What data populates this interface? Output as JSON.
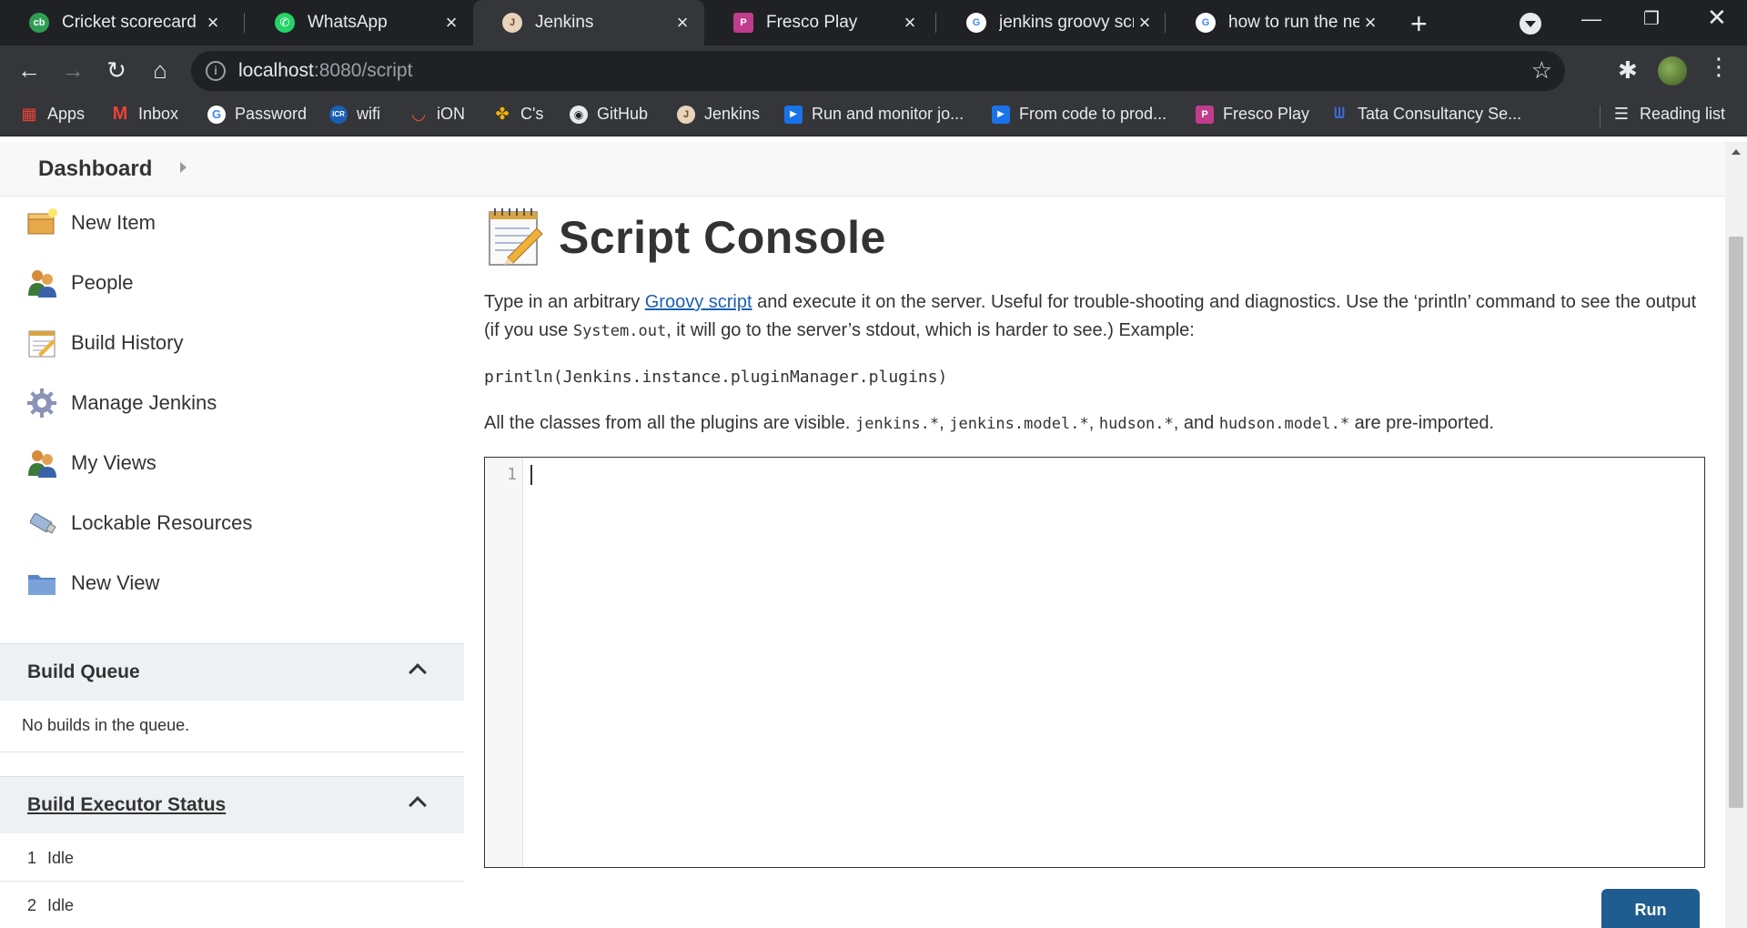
{
  "tabs": [
    {
      "title": "Cricket scorecard - I",
      "icon": "cricbuzz-icon",
      "color": "#2e9e55",
      "glyph": "cb"
    },
    {
      "title": "WhatsApp",
      "icon": "whatsapp-icon",
      "color": "#25d366",
      "glyph": "✆"
    },
    {
      "title": "Jenkins",
      "icon": "jenkins-icon",
      "color": "#d3b08a",
      "glyph": "J"
    },
    {
      "title": "Fresco Play",
      "icon": "fresco-icon",
      "color": "#c03c8c",
      "glyph": "P"
    },
    {
      "title": "jenkins groovy scrip",
      "icon": "google-icon",
      "color": "#ffffff",
      "glyph": "G"
    },
    {
      "title": "how to run the nex",
      "icon": "google-icon",
      "color": "#ffffff",
      "glyph": "G"
    }
  ],
  "toolbar": {
    "url_host": "localhost",
    "url_path": ":8080/script"
  },
  "bookmarks": [
    {
      "label": "Apps",
      "icon": "apps-grid-icon",
      "color": "#ea4335"
    },
    {
      "label": "Inbox",
      "icon": "gmail-icon",
      "color": "#ea4335"
    },
    {
      "label": "Password",
      "icon": "google-icon",
      "color": "#4285f4"
    },
    {
      "label": "wifi",
      "icon": "icr-icon",
      "color": "#1a5fb4"
    },
    {
      "label": "iON",
      "icon": "ion-icon",
      "color": "#e8572c"
    },
    {
      "label": "C's",
      "icon": "pinwheel-icon",
      "color": "#f4b400"
    },
    {
      "label": "GitHub",
      "icon": "github-icon",
      "color": "#e8eaed"
    },
    {
      "label": "Jenkins",
      "icon": "jenkins-icon",
      "color": "#d3b08a"
    },
    {
      "label": "Run and monitor jo...",
      "icon": "play-video-icon",
      "color": "#1a73e8"
    },
    {
      "label": "From code to prod...",
      "icon": "play-video-icon",
      "color": "#1a73e8"
    },
    {
      "label": "Fresco Play",
      "icon": "fresco-icon",
      "color": "#c03c8c"
    },
    {
      "label": "Tata Consultancy Se...",
      "icon": "tcs-icon",
      "color": "#3b6de0"
    }
  ],
  "reading_list": "Reading list",
  "breadcrumb": {
    "dashboard": "Dashboard"
  },
  "sidebar": {
    "items": [
      {
        "label": "New Item"
      },
      {
        "label": "People"
      },
      {
        "label": "Build History"
      },
      {
        "label": "Manage Jenkins"
      },
      {
        "label": "My Views"
      },
      {
        "label": "Lockable Resources"
      },
      {
        "label": "New View"
      }
    ]
  },
  "build_queue": {
    "title": "Build Queue",
    "empty_text": "No builds in the queue."
  },
  "executors": {
    "title": "Build Executor Status",
    "rows": [
      {
        "num": "1",
        "status": "Idle"
      },
      {
        "num": "2",
        "status": "Idle"
      }
    ]
  },
  "main": {
    "title": "Script Console",
    "desc_pre": "Type in an arbitrary ",
    "desc_link": "Groovy script",
    "desc_mid": " and execute it on the server. Useful for trouble-shooting and diagnostics. Use the ‘println’ command to see the output (if you use ",
    "desc_code": "System.out",
    "desc_post": ", it will go to the server’s stdout, which is harder to see.) Example:",
    "example": "println(Jenkins.instance.pluginManager.plugins)",
    "classes_pre": "All the classes from all the plugins are visible. ",
    "pkg1": "jenkins.*",
    "sep1": ", ",
    "pkg2": "jenkins.model.*",
    "sep2": ", ",
    "pkg3": "hudson.*",
    "sep3": ", and ",
    "pkg4": "hudson.model.*",
    "classes_post": " are pre-imported.",
    "line_number": "1",
    "run_label": "Run"
  }
}
